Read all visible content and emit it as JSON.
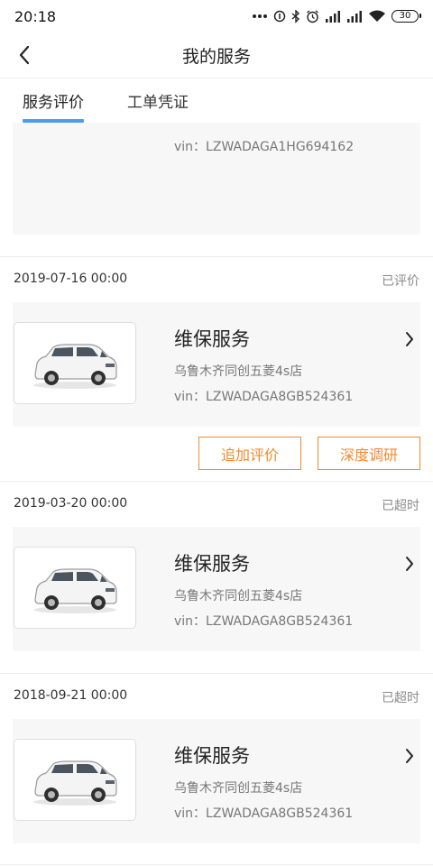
{
  "status_bar": {
    "time": "20:18",
    "battery": "30",
    "icons": [
      "more-dots-icon",
      "sync-icon",
      "bluetooth-icon",
      "alarm-icon",
      "signal-icon",
      "signal-icon",
      "wifi-icon",
      "battery-icon"
    ]
  },
  "header": {
    "title": "我的服务",
    "back_icon": "chevron-left-icon"
  },
  "tabs": [
    {
      "label": "服务评价",
      "active": true
    },
    {
      "label": "工单凭证",
      "active": false
    }
  ],
  "colors": {
    "accent_tab": "#4a9df0",
    "action_orange": "#f08a2e",
    "card_bg": "#f7f7f7"
  },
  "partial_card": {
    "vin": "vin：LZWADAGA1HG694162"
  },
  "orders": [
    {
      "date": "2019-07-16 00:00",
      "status": "已评价",
      "title": "维保服务",
      "store": "乌鲁木齐同创五菱4s店",
      "vin": "vin：LZWADAGA8GB524361",
      "actions": [
        "追加评价",
        "深度调研"
      ]
    },
    {
      "date": "2019-03-20 00:00",
      "status": "已超时",
      "title": "维保服务",
      "store": "乌鲁木齐同创五菱4s店",
      "vin": "vin：LZWADAGA8GB524361"
    },
    {
      "date": "2018-09-21 00:00",
      "status": "已超时",
      "title": "维保服务",
      "store": "乌鲁木齐同创五菱4s店",
      "vin": "vin：LZWADAGA8GB524361"
    }
  ]
}
